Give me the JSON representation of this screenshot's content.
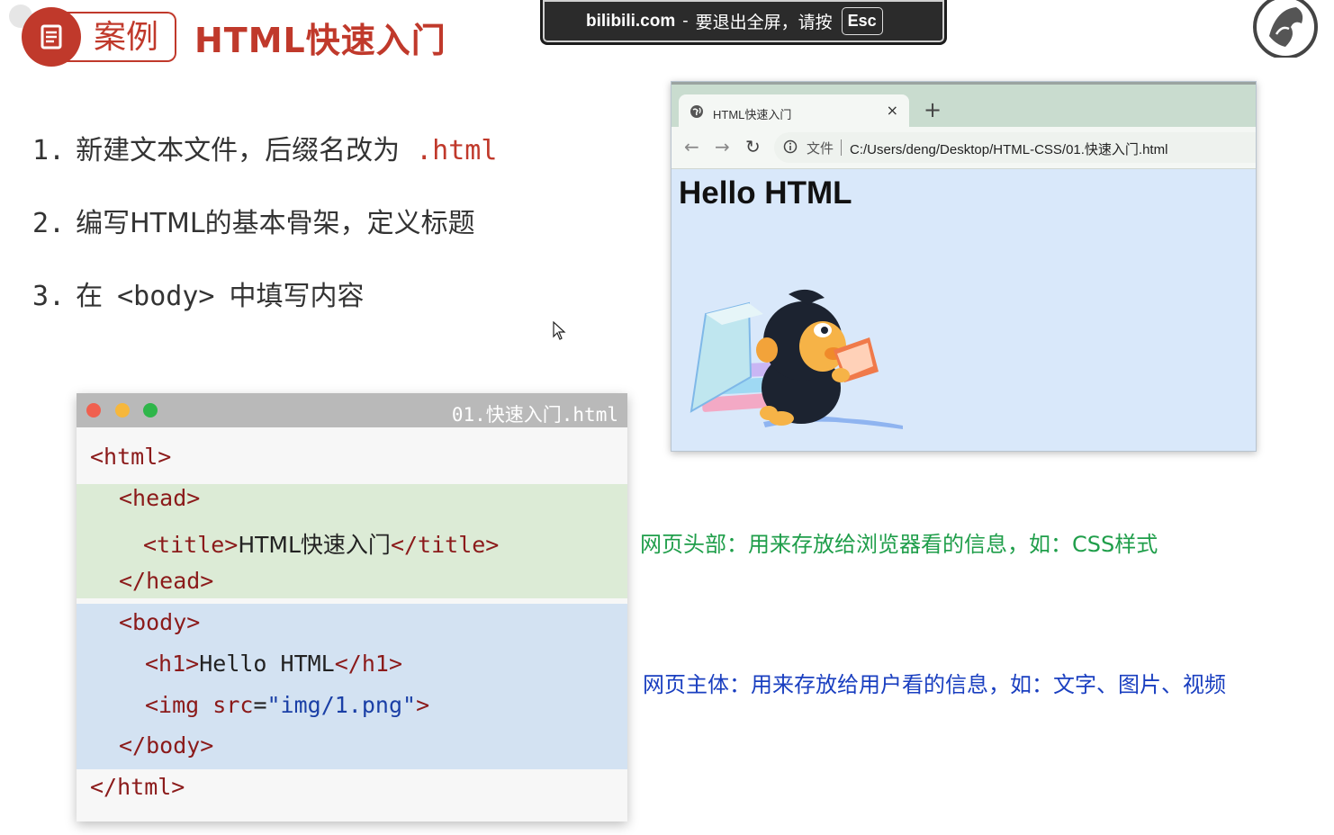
{
  "header": {
    "badge_label": "案例",
    "title": "HTML快速入门"
  },
  "fullscreen_banner": {
    "site": "bilibili.com",
    "separator": "-",
    "message": "要退出全屏，请按",
    "key": "Esc"
  },
  "steps": [
    {
      "number": "1.",
      "text": "新建文本文件，后缀名改为",
      "code": ".html"
    },
    {
      "number": "2.",
      "text": "编写HTML的基本骨架，定义标题"
    },
    {
      "number": "3.",
      "prefix": "在",
      "code": "<body>",
      "suffix": "中填写内容"
    }
  ],
  "editor": {
    "filename": "01.快速入门.html",
    "lines": {
      "html_open": "<html>",
      "head_open": "<head>",
      "title_open": "<title>",
      "title_text": "HTML快速入门",
      "title_close": "</title>",
      "head_close": "</head>",
      "body_open": "<body>",
      "h1_open": "<h1>",
      "h1_text": "Hello HTML",
      "h1_close": "</h1>",
      "img_open": "<img",
      "img_attr": "src",
      "img_eq": "=",
      "img_value": "\"img/1.png\"",
      "img_end": ">",
      "body_close": "</body>",
      "html_close": "</html>"
    },
    "traffic_colors": [
      "#f0604f",
      "#f6b73c",
      "#2fb64a"
    ]
  },
  "browser": {
    "tab_title": "HTML快速入门",
    "tab_close": "×",
    "new_tab": "+",
    "url_scheme": "文件",
    "url": "C:/Users/deng/Desktop/HTML-CSS/01.快速入门.html",
    "page_heading": "Hello HTML",
    "image_icon": "monkey-reading-books-illustration"
  },
  "annotations": {
    "head_note": "网页头部：用来存放给浏览器看的信息，如：CSS样式",
    "body_note": "网页主体：用来存放给用户看的信息，如：文字、图片、视频"
  },
  "colors": {
    "accent_red": "#c0392b",
    "head_band": "#dcebd6",
    "body_band": "#d3e2f2",
    "note_green": "#1f9e4a",
    "note_blue": "#1a3fc0"
  }
}
